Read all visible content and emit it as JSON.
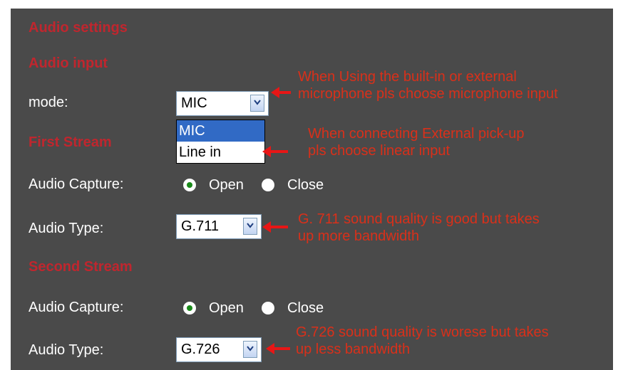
{
  "headings": {
    "audio_settings": "Audio settings",
    "audio_input": "Audio input",
    "first_stream": "First Stream",
    "second_stream": "Second Stream"
  },
  "mode": {
    "label": "mode:",
    "selected": "MIC",
    "options": [
      "MIC",
      "Line in"
    ],
    "highlighted_option": "MIC"
  },
  "first_stream": {
    "capture_label": "Audio Capture:",
    "open_label": "Open",
    "close_label": "Close",
    "capture_selected": "Open",
    "type_label": "Audio Type:",
    "type_selected": "G.711"
  },
  "second_stream": {
    "capture_label": "Audio Capture:",
    "open_label": "Open",
    "close_label": "Close",
    "capture_selected": "Open",
    "type_label": "Audio Type:",
    "type_selected": "G.726"
  },
  "annotations": {
    "mic_line1": "When Using the built-in or external",
    "mic_line2": "microphone pls choose microphone input",
    "linein_line1": "When connecting External pick-up",
    "linein_line2": "pls choose linear input",
    "g711_line1": "G. 711 sound quality is good but takes",
    "g711_line2": "up more bandwidth",
    "g726_line1": "G.726 sound quality is worese but takes",
    "g726_line2": "up less bandwidth"
  },
  "colors": {
    "panel_bg": "#4a4a4a",
    "heading": "#c0262e",
    "annotation": "#d9301a",
    "arrow": "#e81616",
    "selection": "#316ac5"
  }
}
